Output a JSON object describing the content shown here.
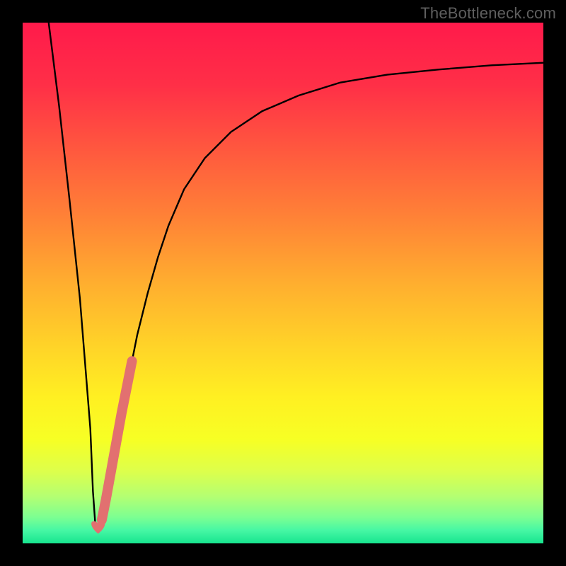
{
  "watermark": "TheBottleneck.com",
  "colors": {
    "frame": "#000000",
    "curve_black": "#000000",
    "marker_pink": "#e27070",
    "gradient_stops": [
      {
        "offset": 0.0,
        "color": "#ff1a4b"
      },
      {
        "offset": 0.12,
        "color": "#ff2f47"
      },
      {
        "offset": 0.25,
        "color": "#ff5a3e"
      },
      {
        "offset": 0.38,
        "color": "#ff8436"
      },
      {
        "offset": 0.5,
        "color": "#ffae2f"
      },
      {
        "offset": 0.62,
        "color": "#ffd328"
      },
      {
        "offset": 0.72,
        "color": "#fff022"
      },
      {
        "offset": 0.8,
        "color": "#f7ff24"
      },
      {
        "offset": 0.86,
        "color": "#deff4a"
      },
      {
        "offset": 0.91,
        "color": "#b4ff72"
      },
      {
        "offset": 0.95,
        "color": "#7cff92"
      },
      {
        "offset": 0.975,
        "color": "#46f7a4"
      },
      {
        "offset": 1.0,
        "color": "#17e58f"
      }
    ]
  },
  "chart_data": {
    "type": "line",
    "title": "",
    "xlabel": "",
    "ylabel": "",
    "xlim": [
      0,
      100
    ],
    "ylim": [
      0,
      100
    ],
    "series": [
      {
        "name": "bottleneck-curve",
        "x": [
          5,
          7,
          9,
          11,
          13,
          13.5,
          14,
          15,
          16,
          18,
          20,
          22,
          24,
          26,
          28,
          31,
          35,
          40,
          46,
          53,
          61,
          70,
          80,
          90,
          100
        ],
        "y": [
          100,
          84,
          66,
          47,
          22,
          10,
          3,
          4,
          8,
          19,
          30,
          40,
          48,
          55,
          61,
          68,
          74,
          79,
          83,
          86,
          88.5,
          90,
          91,
          91.8,
          92.3
        ]
      },
      {
        "name": "highlight-segment",
        "x": [
          15.2,
          16.0,
          17.0,
          18.0,
          19.0,
          20.0,
          21.0
        ],
        "y": [
          4.5,
          8.5,
          14.0,
          19.5,
          25.0,
          30.0,
          35.0
        ]
      }
    ],
    "markers": [
      {
        "name": "heart-marker",
        "x": 14.5,
        "y": 3.2
      }
    ]
  }
}
